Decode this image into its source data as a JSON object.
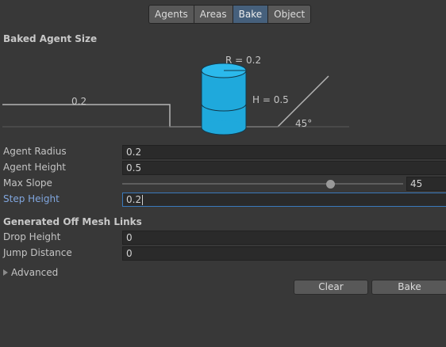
{
  "tabs": [
    {
      "label": "Agents",
      "active": false
    },
    {
      "label": "Areas",
      "active": false
    },
    {
      "label": "Bake",
      "active": true
    },
    {
      "label": "Object",
      "active": false
    }
  ],
  "baked_agent_size": {
    "title": "Baked Agent Size",
    "diagram": {
      "step_label": "0.2",
      "radius_label": "R = 0.2",
      "height_label": "H = 0.5",
      "slope_label": "45°"
    }
  },
  "fields": {
    "agent_radius": {
      "label": "Agent Radius",
      "value": "0.2"
    },
    "agent_height": {
      "label": "Agent Height",
      "value": "0.5"
    },
    "max_slope": {
      "label": "Max Slope",
      "value": "45",
      "min": 0,
      "max": 60
    },
    "step_height": {
      "label": "Step Height",
      "value": "0.2",
      "focused": true
    }
  },
  "off_mesh": {
    "title": "Generated Off Mesh Links",
    "drop_height": {
      "label": "Drop Height",
      "value": "0"
    },
    "jump_distance": {
      "label": "Jump Distance",
      "value": "0"
    }
  },
  "advanced": {
    "label": "Advanced",
    "expanded": false
  },
  "buttons": {
    "clear": "Clear",
    "bake": "Bake"
  },
  "colors": {
    "accent": "#46607c",
    "focus_label": "#80a6de",
    "cylinder": "#1fa9dc"
  }
}
